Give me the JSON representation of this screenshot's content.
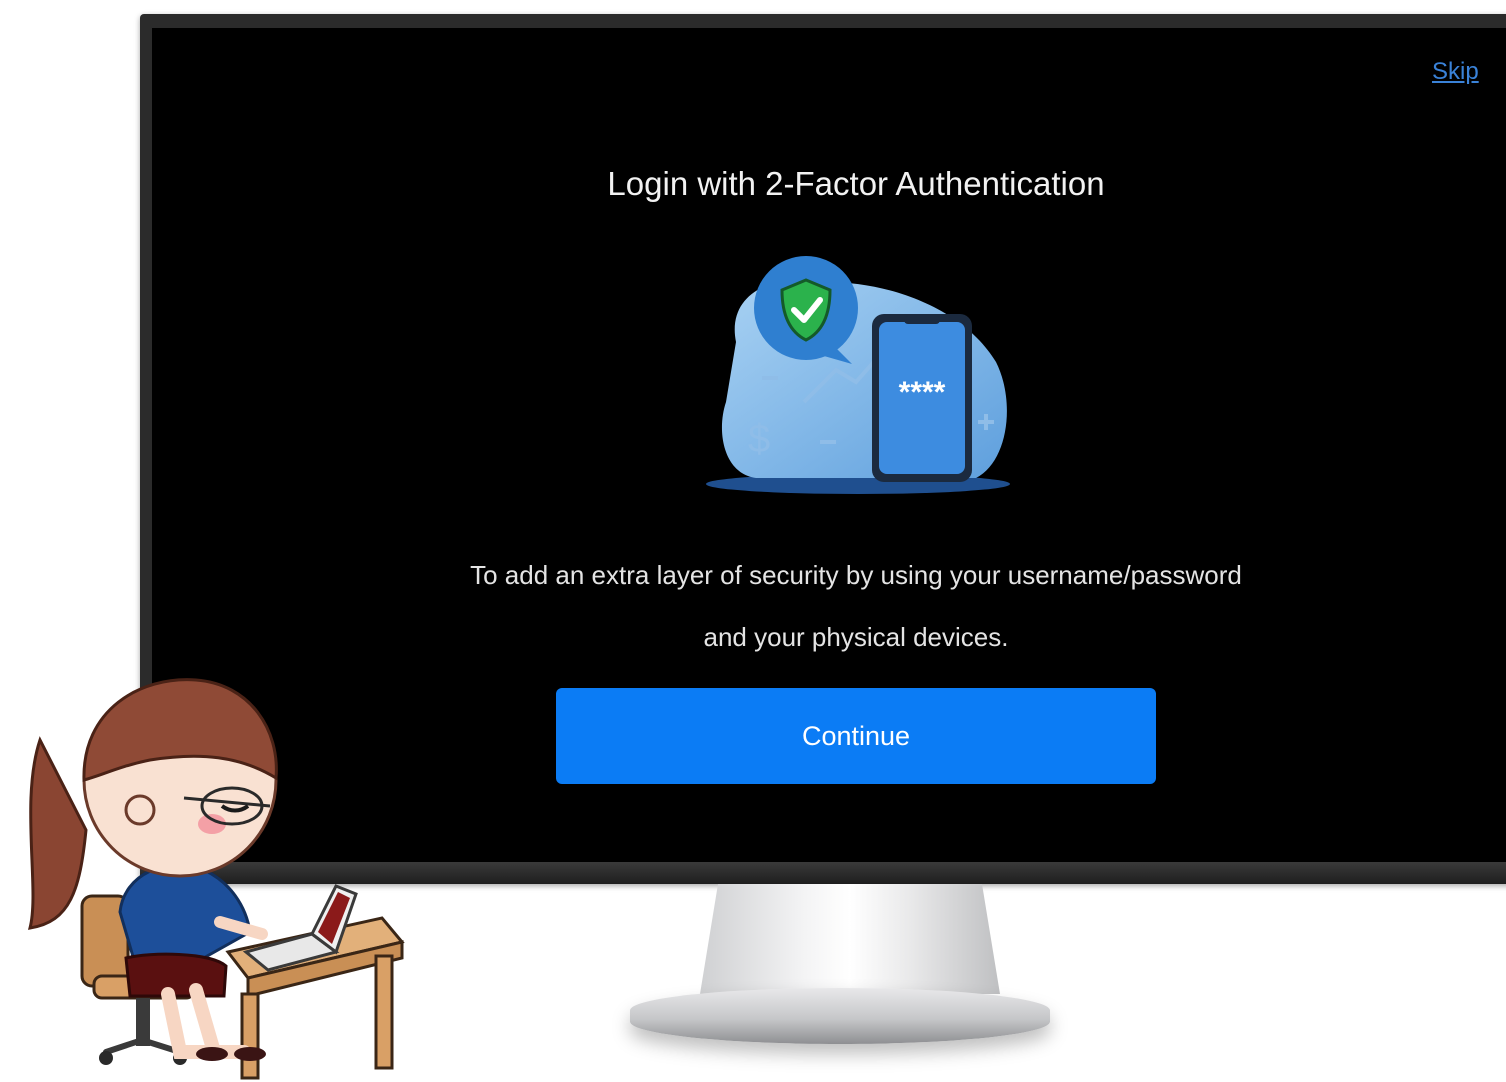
{
  "screen": {
    "skip_label": "Skip",
    "title": "Login with 2-Factor Authentication",
    "description_line1": "To add an extra layer of security by using your username/password",
    "description_line2": "and your physical devices.",
    "continue_label": "Continue",
    "illustration": {
      "phone_code": "****",
      "icons": [
        "shield-check-icon",
        "phone-icon",
        "dollar-icon"
      ]
    }
  },
  "colors": {
    "screen_background": "#000000",
    "accent_button": "#0b7cf5",
    "link": "#3a82d8",
    "shield": "#2bb24c"
  }
}
